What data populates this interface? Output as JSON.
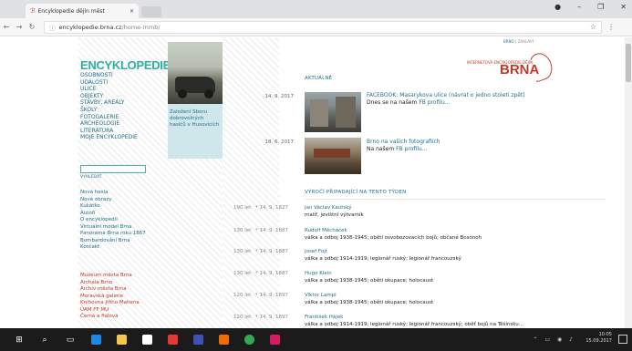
{
  "browser": {
    "tab_title": "Encyklopedie dějin měst",
    "url_domain": "encyklopedie.brna.cz",
    "url_path": "/home-mmb/",
    "window_min": "–",
    "window_max": "❐",
    "window_close": "✕"
  },
  "site": {
    "logo": "ENCYKLOPEDIE",
    "menu": [
      "OSOBNOSTI",
      "UDÁLOSTI",
      "ULICE",
      "OBJEKTY",
      "STAVBY, AREÁLY",
      "ŠKOLY",
      "FOTOGALERIE",
      "ARCHEOLOGIE",
      "LITERATURA",
      "MOJE ENCYKLOPEDIE"
    ],
    "search_label": "VYHLEDAT",
    "links_blue": [
      "Nová hesla",
      "Nové obrazy",
      "Kukátko",
      "Autoři",
      "O encyklopedii",
      "Virtuální model Brna",
      "Panorama Brna roku 1867",
      "Bombardování Brna",
      "Kontakt"
    ],
    "links_red": [
      "Muzeum města Brna",
      "Archaia Brno",
      "Archiv města Brna",
      "Moravská galerie",
      "Knihovna Jiřího Mahena",
      "ÚAM FF MU",
      "Černá a fialová"
    ],
    "photo_caption": "Založení Sboru dobrovolných hasičů v Husovicích",
    "langs_active": "BRNO",
    "langs_other": "ZAHLAVÍ",
    "brand_small": "INTERNETOVÁ ENCYKLOPEDIE DĚJIN",
    "brand_big": "BRNA"
  },
  "news": {
    "section_title": "AKTUÁLNĚ",
    "items": [
      {
        "date": "14. 9. 2017",
        "title": "FACEBOOK: Masarykova ulice (návrat o jedno století zpět)",
        "desc": "Dnes se na našem ",
        "link": "FB profilu..."
      },
      {
        "date": "18. 6. 2017",
        "title": "Brno na vašich fotografiích",
        "desc": "Na našem ",
        "link": "FB profilu..."
      }
    ]
  },
  "anniversaries": {
    "section_title": "VÝROČÍ PŘIPADAJÍCÍ NA TENTO TÝDEN",
    "items": [
      {
        "age": "190 let",
        "date": "* 14. 9. 1827",
        "name": "Jan Václav Kautský",
        "desc": "malíř, jevištní výtvarník"
      },
      {
        "age": "130 let",
        "date": "* 14. 9. 1887",
        "name": "Rudolf Měcháček",
        "desc": "válka a odboj 1938-1945; oběti osvobozovacích bojů; občané Bosonoh"
      },
      {
        "age": "130 let",
        "date": "* 14. 9. 1887",
        "name": "Josef Fojt",
        "desc": "válka a odboj 1914-1919; legionář ruský; legionář francouzský"
      },
      {
        "age": "130 let",
        "date": "* 14. 9. 1887",
        "name": "Hugo Klein",
        "desc": "válka a odboj 1938-1945; oběti okupace; holocaust"
      },
      {
        "age": "120 let",
        "date": "* 14. 9. 1897",
        "name": "Viktor Lampl",
        "desc": "válka a odboj 1938-1945; oběti okupace; holocaust"
      },
      {
        "age": "120 let",
        "date": "* 14. 9. 1897",
        "name": "František Hájek",
        "desc": "válka a odboj 1914-1919; legionář ruský; legionář francouzský; oběť bojů na Těšínsku..."
      }
    ]
  },
  "taskbar": {
    "time": "10:05",
    "date": "15.09.2017"
  }
}
